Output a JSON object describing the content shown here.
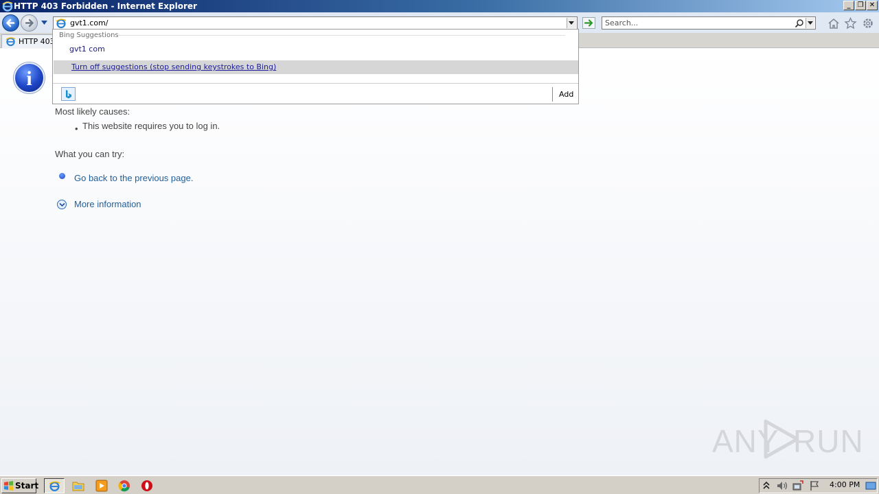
{
  "window": {
    "title": "HTTP 403 Forbidden - Internet Explorer",
    "controls": {
      "minimize": "_",
      "restore": "❐",
      "close": "✕"
    }
  },
  "navbar": {
    "address_value": "gvt1.com/",
    "search_placeholder": "Search..."
  },
  "tab": {
    "label": "HTTP 403"
  },
  "suggestions": {
    "header": "Bing Suggestions",
    "items": [
      "gvt1 com"
    ],
    "turn_off_label": "Turn off suggestions (stop sending keystrokes to Bing)",
    "add_label": "Add"
  },
  "page": {
    "causes_heading": "Most likely causes:",
    "causes": [
      "This website requires you to log in."
    ],
    "try_heading": "What you can try:",
    "back_link": "Go back to the previous page.",
    "more_info_link": "More information"
  },
  "watermark": {
    "left": "ANY",
    "right": "RUN"
  },
  "taskbar": {
    "start_label": "Start",
    "icons": [
      "internet-explorer-icon",
      "folder-icon",
      "media-player-icon",
      "chrome-icon",
      "opera-icon"
    ],
    "clock": "4:00 PM"
  },
  "colors": {
    "titlebar_start": "#0a246a",
    "link": "#1f5e9c",
    "suggestion_highlight": "#d6d6d6",
    "taskbar": "#d4d0c8"
  }
}
